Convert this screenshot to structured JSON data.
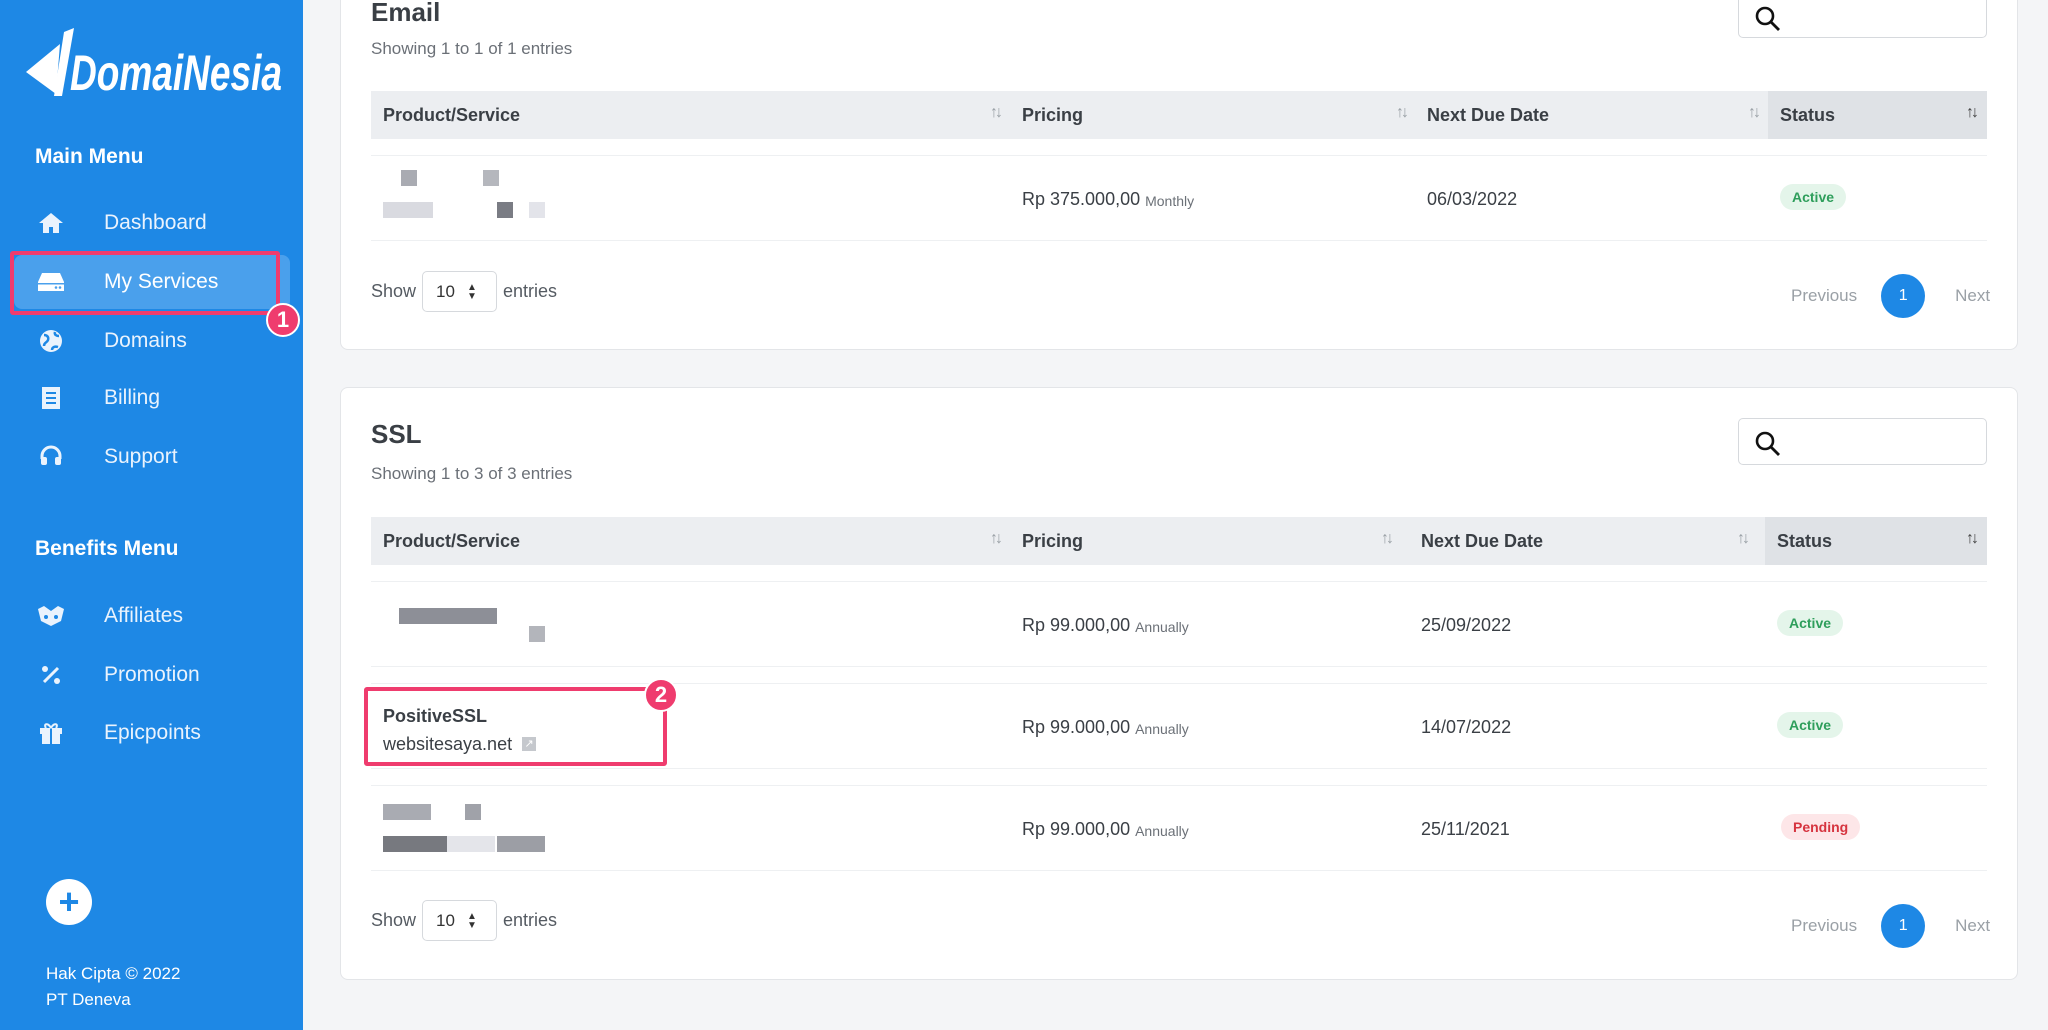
{
  "sidebar": {
    "logo_text": "DomaiNesia",
    "main_menu_title": "Main Menu",
    "main_items": [
      {
        "label": "Dashboard",
        "icon": "home-icon"
      },
      {
        "label": "My Services",
        "icon": "server-icon",
        "active": true
      },
      {
        "label": "Domains",
        "icon": "globe-icon"
      },
      {
        "label": "Billing",
        "icon": "receipt-icon"
      },
      {
        "label": "Support",
        "icon": "headset-icon"
      }
    ],
    "benefits_menu_title": "Benefits Menu",
    "benefit_items": [
      {
        "label": "Affiliates",
        "icon": "handshake-icon"
      },
      {
        "label": "Promotion",
        "icon": "percent-icon"
      },
      {
        "label": "Epicpoints",
        "icon": "gift-icon"
      }
    ],
    "add_icon": "plus-icon",
    "copyright": "Hak Cipta © 2022",
    "company": "PT Deneva"
  },
  "annotations": {
    "step1": "1",
    "step2": "2",
    "color": "#ef3c6e"
  },
  "columns": [
    "Product/Service",
    "Pricing",
    "Next Due Date",
    "Status"
  ],
  "email": {
    "title": "Email",
    "showing": "Showing 1 to 1 of 1 entries",
    "rows": [
      {
        "product": "",
        "domain": "",
        "price": "Rp 375.000,00",
        "cycle": "Monthly",
        "due": "06/03/2022",
        "status": "Active"
      }
    ],
    "show": "Show",
    "entries_value": "10",
    "entries": "entries",
    "prev": "Previous",
    "page": "1",
    "next": "Next"
  },
  "ssl": {
    "title": "SSL",
    "showing": "Showing 1 to 3 of 3 entries",
    "rows": [
      {
        "product": "",
        "domain": "",
        "price": "Rp 99.000,00",
        "cycle": "Annually",
        "due": "25/09/2022",
        "status": "Active"
      },
      {
        "product": "PositiveSSL",
        "domain": "websitesaya.net",
        "price": "Rp 99.000,00",
        "cycle": "Annually",
        "due": "14/07/2022",
        "status": "Active"
      },
      {
        "product": "",
        "domain": "",
        "price": "Rp 99.000,00",
        "cycle": "Annually",
        "due": "25/11/2021",
        "status": "Pending"
      }
    ],
    "show": "Show",
    "entries_value": "10",
    "entries": "entries",
    "prev": "Previous",
    "page": "1",
    "next": "Next"
  },
  "colors": {
    "sidebar": "#1e88e5",
    "active": "#2e9e5b",
    "pending": "#d6343f"
  }
}
